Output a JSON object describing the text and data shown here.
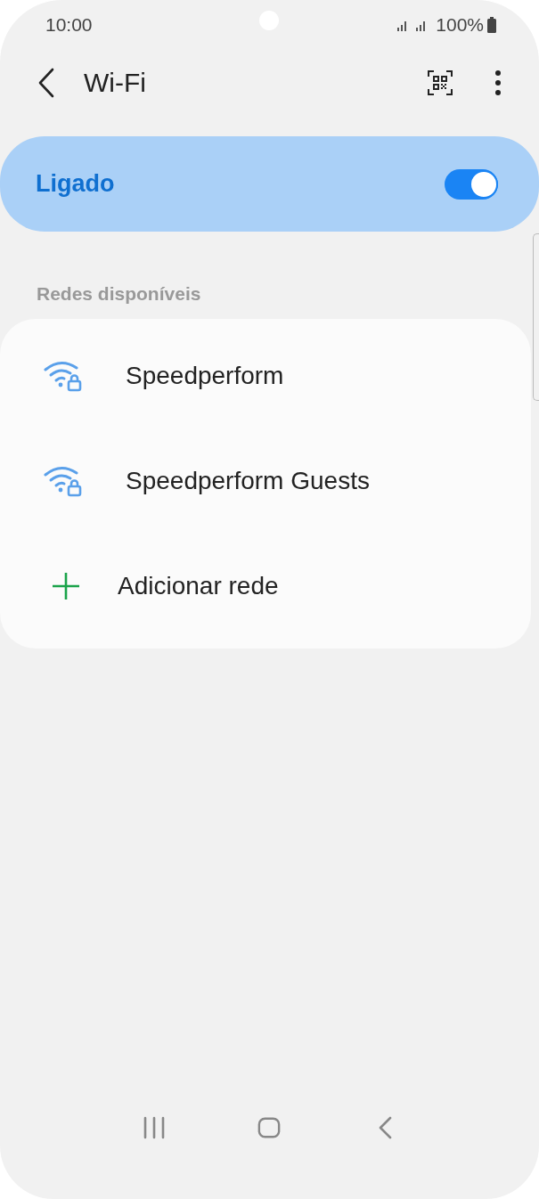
{
  "status_bar": {
    "time": "10:00",
    "battery": "100%"
  },
  "header": {
    "title": "Wi-Fi"
  },
  "master_switch": {
    "label": "Ligado",
    "on": true
  },
  "section": {
    "title": "Redes disponíveis"
  },
  "networks": [
    {
      "kind": "network",
      "name": "Speedperform",
      "secured": true
    },
    {
      "kind": "network",
      "name": "Speedperform Guests",
      "secured": true
    },
    {
      "kind": "add",
      "name": "Adicionar rede"
    }
  ]
}
